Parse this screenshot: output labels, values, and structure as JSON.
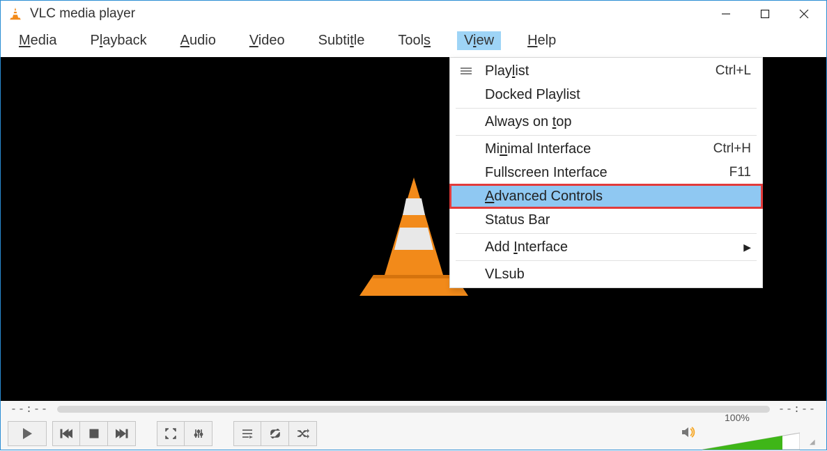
{
  "window": {
    "title": "VLC media player"
  },
  "menubar": {
    "items": [
      {
        "label": "Media",
        "pre": "",
        "u": "M",
        "post": "edia"
      },
      {
        "label": "Playback",
        "pre": "P",
        "u": "l",
        "post": "ayback"
      },
      {
        "label": "Audio",
        "pre": "",
        "u": "A",
        "post": "udio"
      },
      {
        "label": "Video",
        "pre": "",
        "u": "V",
        "post": "ideo"
      },
      {
        "label": "Subtitle",
        "pre": "Subti",
        "u": "t",
        "post": "le"
      },
      {
        "label": "Tools",
        "pre": "Tool",
        "u": "s",
        "post": ""
      },
      {
        "label": "View",
        "pre": "V",
        "u": "i",
        "post": "ew",
        "open": true
      },
      {
        "label": "Help",
        "pre": "",
        "u": "H",
        "post": "elp"
      }
    ]
  },
  "view_menu": {
    "items": [
      {
        "kind": "item",
        "label": "Playlist",
        "pre": "Play",
        "u": "l",
        "post": "ist",
        "shortcut": "Ctrl+L",
        "icon": "playlist"
      },
      {
        "kind": "item",
        "label": "Docked Playlist",
        "pre": "Docked Playlist",
        "u": "",
        "post": "",
        "shortcut": ""
      },
      {
        "kind": "sep"
      },
      {
        "kind": "item",
        "label": "Always on top",
        "pre": "Always on ",
        "u": "t",
        "post": "op",
        "shortcut": ""
      },
      {
        "kind": "sep"
      },
      {
        "kind": "item",
        "label": "Minimal Interface",
        "pre": "Mi",
        "u": "n",
        "post": "imal Interface",
        "shortcut": "Ctrl+H"
      },
      {
        "kind": "item",
        "label": "Fullscreen Interface",
        "pre": "Fullscreen Interface",
        "u": "",
        "post": "",
        "shortcut": "F11"
      },
      {
        "kind": "item",
        "label": "Advanced Controls",
        "pre": "",
        "u": "A",
        "post": "dvanced Controls",
        "shortcut": "",
        "highlight": true
      },
      {
        "kind": "item",
        "label": "Status Bar",
        "pre": "Status Bar",
        "u": "",
        "post": "",
        "shortcut": ""
      },
      {
        "kind": "sep"
      },
      {
        "kind": "item",
        "label": "Add Interface",
        "pre": "Add ",
        "u": "I",
        "post": "nterface",
        "shortcut": "",
        "submenu": true
      },
      {
        "kind": "sep"
      },
      {
        "kind": "item",
        "label": "VLsub",
        "pre": "VLsub",
        "u": "",
        "post": "",
        "shortcut": ""
      }
    ]
  },
  "seekbar": {
    "elapsed": "--:--",
    "remaining": "--:--"
  },
  "controls": {
    "play": "play",
    "prev": "previous",
    "stop": "stop",
    "next": "next",
    "fullscreen": "fullscreen",
    "ext": "extended-settings",
    "playlist": "toggle-playlist",
    "loop": "loop",
    "shuffle": "shuffle"
  },
  "volume": {
    "label": "100%",
    "value": 100
  }
}
